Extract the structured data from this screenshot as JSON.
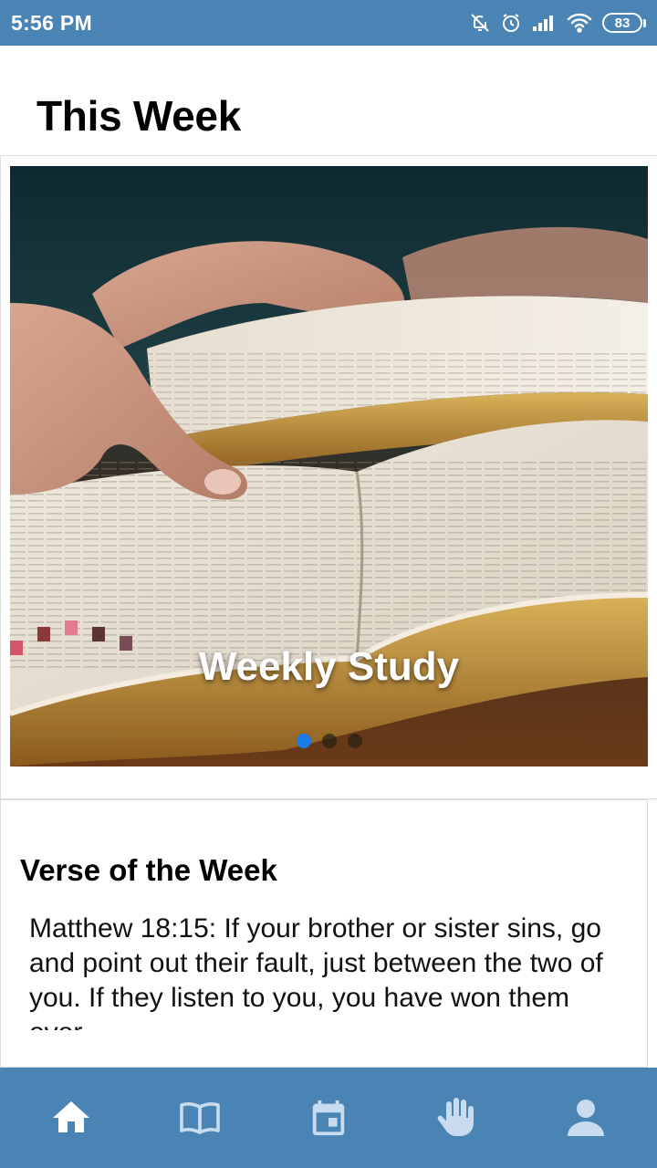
{
  "status_bar": {
    "time": "5:56 PM",
    "battery": "83"
  },
  "header": {
    "title": "This Week"
  },
  "carousel": {
    "slide_title": "Weekly Study",
    "slide_count": 3,
    "active_index": 0
  },
  "verse": {
    "heading": "Verse of the Week",
    "text": "Matthew 18:15: If your brother or sister sins, go and point out their fault, just between the two of you. If they listen to you, you have won them over."
  },
  "nav": {
    "items": [
      {
        "icon": "home-icon",
        "active": true
      },
      {
        "icon": "book-icon",
        "active": false
      },
      {
        "icon": "calendar-icon",
        "active": false
      },
      {
        "icon": "hand-icon",
        "active": false
      },
      {
        "icon": "person-icon",
        "active": false
      }
    ]
  },
  "colors": {
    "primary": "#4a84b5",
    "dot_active": "#1a7be4",
    "nav_icon_active": "#ffffff",
    "nav_icon_inactive": "#c9dcef"
  }
}
